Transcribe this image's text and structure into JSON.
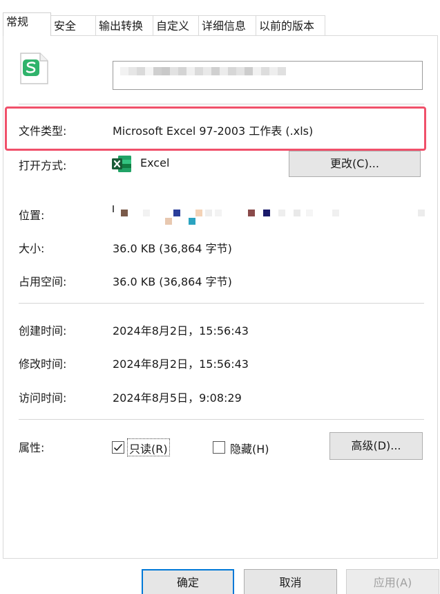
{
  "tabs": [
    {
      "label": "常规"
    },
    {
      "label": "安全"
    },
    {
      "label": "输出转换"
    },
    {
      "label": "自定义"
    },
    {
      "label": "详细信息"
    },
    {
      "label": "以前的版本"
    }
  ],
  "general": {
    "file_type_label": "文件类型:",
    "file_type_value": "Microsoft Excel 97-2003 工作表 (.xls)",
    "open_with_label": "打开方式:",
    "open_with_app": "Excel",
    "change_button": "更改(C)...",
    "location_label": "位置:",
    "size_label": "大小:",
    "size_value": "36.0 KB (36,864 字节)",
    "disk_size_label": "占用空间:",
    "disk_size_value": "36.0 KB (36,864 字节)",
    "created_label": "创建时间:",
    "created_value": "2024年8月2日，15:56:43",
    "modified_label": "修改时间:",
    "modified_value": "2024年8月2日，15:56:43",
    "accessed_label": "访问时间:",
    "accessed_value": "2024年8月5日，9:08:29",
    "attributes_label": "属性:",
    "readonly_label": "只读(R)",
    "readonly_checked": true,
    "hidden_label": "隐藏(H)",
    "hidden_checked": false,
    "advanced_button": "高级(D)..."
  },
  "footer": {
    "ok": "确定",
    "cancel": "取消",
    "apply": "应用(A)"
  },
  "colors": {
    "highlight_border": "#f0506a",
    "excel_green": "#1d7a45",
    "wps_icon_green": "#2fb36b",
    "primary_border": "#0078d7"
  },
  "icons": {
    "file_icon": "wps-spreadsheet-file-icon",
    "app_icon": "excel-icon"
  }
}
